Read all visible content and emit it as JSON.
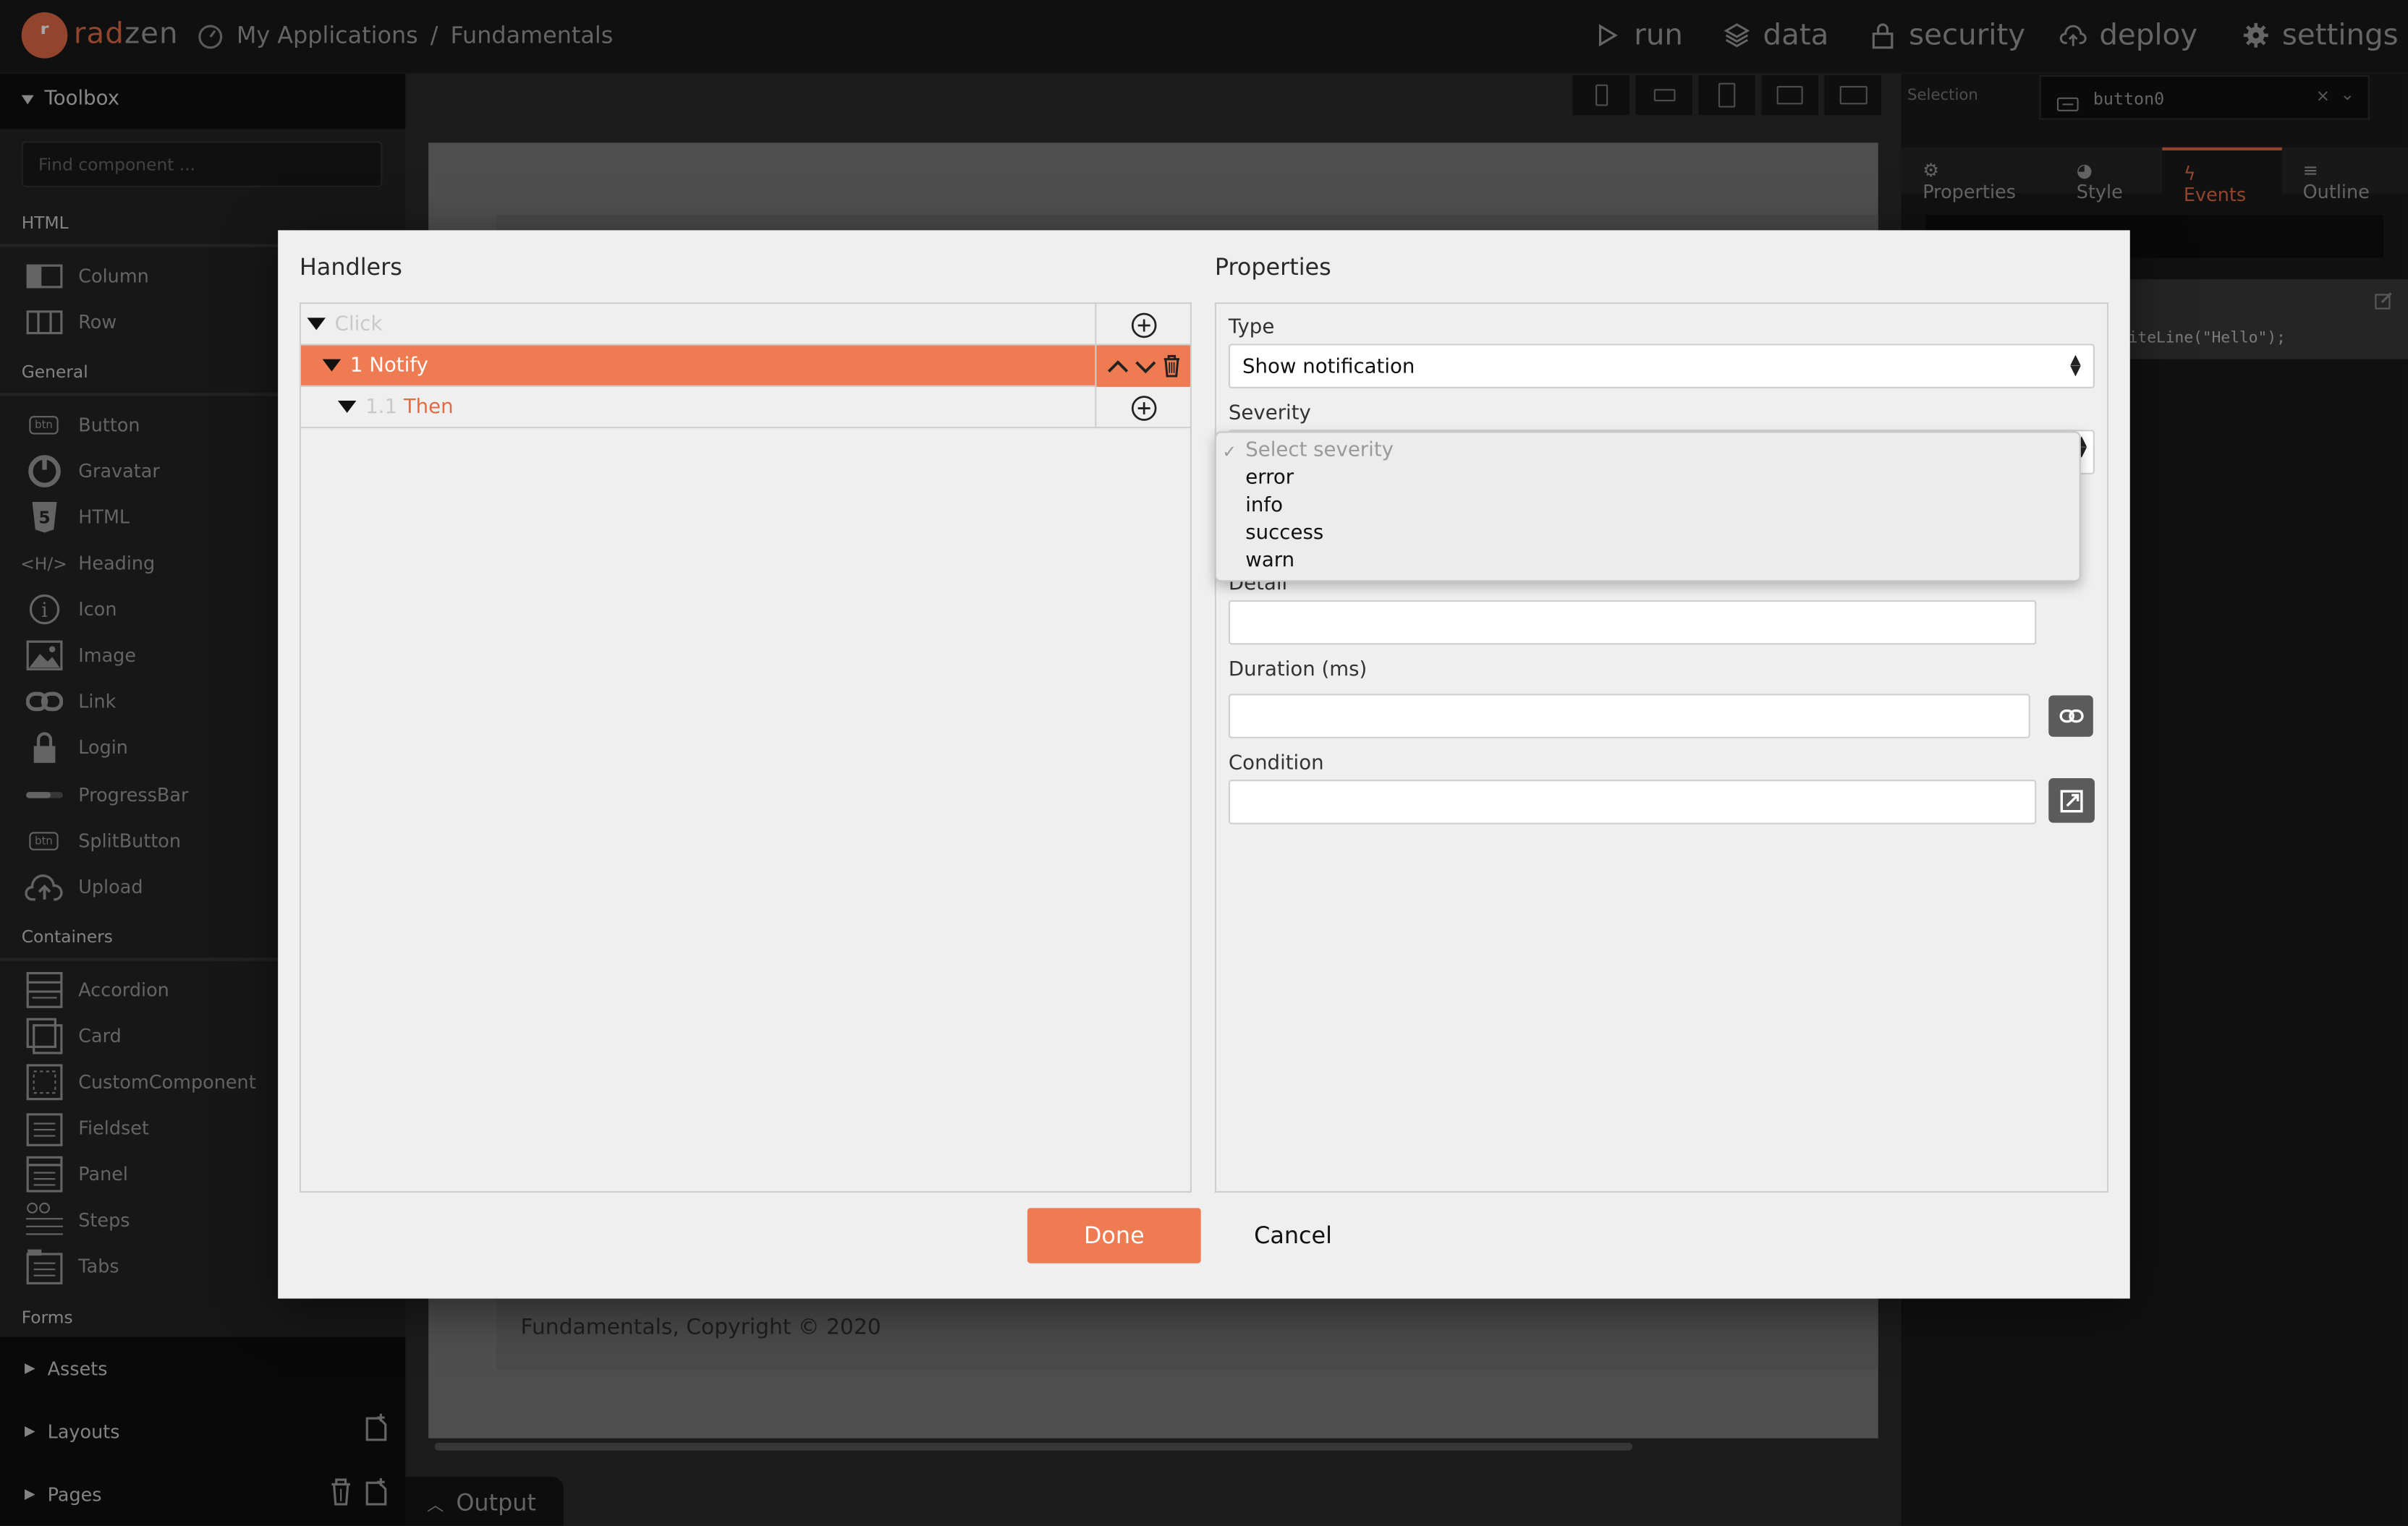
{
  "app": {
    "brand_prefix": "rad",
    "brand_suffix": "zen",
    "breadcrumb_app": "My Applications",
    "breadcrumb_sep": "/",
    "breadcrumb_page": "Fundamentals"
  },
  "nav": {
    "run": "run",
    "data": "data",
    "security": "security",
    "deploy": "deploy",
    "settings": "settings"
  },
  "toolbox": {
    "title": "Toolbox",
    "search_placeholder": "Find component ...",
    "sections": {
      "html": "HTML",
      "general": "General",
      "containers": "Containers",
      "forms": "Forms"
    },
    "html_items": [
      "Column",
      "Row"
    ],
    "general_items": [
      "Button",
      "Gravatar",
      "HTML",
      "Heading",
      "Icon",
      "Image",
      "Link",
      "Login",
      "ProgressBar",
      "SplitButton",
      "Upload"
    ],
    "container_items": [
      "Accordion",
      "Card",
      "CustomComponent",
      "Fieldset",
      "Panel",
      "Steps",
      "Tabs"
    ],
    "bottom": {
      "assets": "Assets",
      "layouts": "Layouts",
      "pages": "Pages"
    }
  },
  "canvas": {
    "footer_text": "Fundamentals, Copyright © 2020",
    "output_label": "Output"
  },
  "right_panel": {
    "selection_label": "Selection",
    "selection_value": "button0",
    "tabs": [
      "Properties",
      "Style",
      "Events",
      "Outline"
    ],
    "active_tab": "Events",
    "code_snippet": "iteLine(\"Hello\");"
  },
  "dialog": {
    "handlers_title": "Handlers",
    "properties_title": "Properties",
    "rows": {
      "event": "Click",
      "action_num": "1",
      "action": "Notify",
      "then_num": "1.1",
      "then": "Then"
    },
    "fields": {
      "type_label": "Type",
      "type_value": "Show notification",
      "severity_label": "Severity",
      "detail_label": "Detail",
      "duration_label": "Duration (ms)",
      "condition_label": "Condition"
    },
    "severity_options": [
      "Select severity",
      "error",
      "info",
      "success",
      "warn"
    ],
    "severity_selected": "Select severity",
    "done": "Done",
    "cancel": "Cancel"
  },
  "colors": {
    "accent": "#ee7b52",
    "brand": "#e06b44"
  }
}
